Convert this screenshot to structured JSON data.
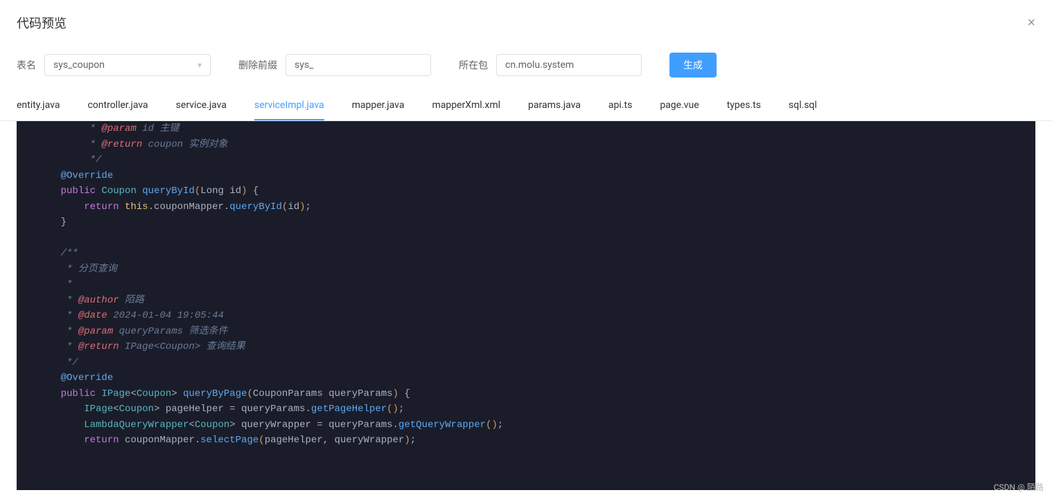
{
  "modal": {
    "title": "代码预览",
    "close": "×"
  },
  "form": {
    "tableLabel": "表名",
    "tableValue": "sys_coupon",
    "prefixLabel": "删除前缀",
    "prefixValue": "sys_",
    "packageLabel": "所在包",
    "packageValue": "cn.molu.system",
    "generateBtn": "生成"
  },
  "tabs": [
    {
      "label": "entity.java",
      "active": false
    },
    {
      "label": "controller.java",
      "active": false
    },
    {
      "label": "service.java",
      "active": false
    },
    {
      "label": "serviceImpl.java",
      "active": true
    },
    {
      "label": "mapper.java",
      "active": false
    },
    {
      "label": "mapperXml.xml",
      "active": false
    },
    {
      "label": "params.java",
      "active": false
    },
    {
      "label": "api.ts",
      "active": false
    },
    {
      "label": "page.vue",
      "active": false
    },
    {
      "label": "types.ts",
      "active": false
    },
    {
      "label": "sql.sql",
      "active": false
    }
  ],
  "code": {
    "lines": [
      {
        "indent": 2,
        "tokens": [
          {
            "t": " * ",
            "c": "comment"
          },
          {
            "t": "@param",
            "c": "doctag"
          },
          {
            "t": " id 主键",
            "c": "comment"
          }
        ]
      },
      {
        "indent": 2,
        "tokens": [
          {
            "t": " * ",
            "c": "comment"
          },
          {
            "t": "@return",
            "c": "doctag"
          },
          {
            "t": " coupon 实例对象",
            "c": "comment"
          }
        ]
      },
      {
        "indent": 2,
        "tokens": [
          {
            "t": " */",
            "c": "comment"
          }
        ]
      },
      {
        "indent": 1,
        "tokens": [
          {
            "t": "@Override",
            "c": "annotation"
          }
        ]
      },
      {
        "indent": 1,
        "tokens": [
          {
            "t": "public",
            "c": "keyword"
          },
          {
            "t": " ",
            "c": ""
          },
          {
            "t": "Coupon",
            "c": "type"
          },
          {
            "t": " ",
            "c": ""
          },
          {
            "t": "queryById",
            "c": "method"
          },
          {
            "t": "(",
            "c": "paren"
          },
          {
            "t": "Long id",
            "c": "var"
          },
          {
            "t": ")",
            "c": "paren"
          },
          {
            "t": " {",
            "c": "punct"
          }
        ]
      },
      {
        "indent": 2,
        "tokens": [
          {
            "t": "return",
            "c": "keyword"
          },
          {
            "t": " ",
            "c": ""
          },
          {
            "t": "this",
            "c": "this"
          },
          {
            "t": ".couponMapper.",
            "c": "var"
          },
          {
            "t": "queryById",
            "c": "method"
          },
          {
            "t": "(",
            "c": "paren"
          },
          {
            "t": "id",
            "c": "var"
          },
          {
            "t": ")",
            "c": "paren"
          },
          {
            "t": ";",
            "c": "punct"
          }
        ]
      },
      {
        "indent": 1,
        "tokens": [
          {
            "t": "}",
            "c": "punct"
          }
        ]
      },
      {
        "indent": 0,
        "tokens": [
          {
            "t": "",
            "c": ""
          }
        ]
      },
      {
        "indent": 1,
        "tokens": [
          {
            "t": "/**",
            "c": "comment"
          }
        ]
      },
      {
        "indent": 1,
        "tokens": [
          {
            "t": " * 分页查询",
            "c": "comment"
          }
        ]
      },
      {
        "indent": 1,
        "tokens": [
          {
            "t": " *",
            "c": "comment"
          }
        ]
      },
      {
        "indent": 1,
        "tokens": [
          {
            "t": " * ",
            "c": "comment"
          },
          {
            "t": "@author",
            "c": "doctag"
          },
          {
            "t": " 陌路",
            "c": "comment"
          }
        ]
      },
      {
        "indent": 1,
        "tokens": [
          {
            "t": " * ",
            "c": "comment"
          },
          {
            "t": "@date",
            "c": "doctag"
          },
          {
            "t": " 2024-01-04 19:05:44",
            "c": "comment"
          }
        ]
      },
      {
        "indent": 1,
        "tokens": [
          {
            "t": " * ",
            "c": "comment"
          },
          {
            "t": "@param",
            "c": "doctag"
          },
          {
            "t": " queryParams 筛选条件",
            "c": "comment"
          }
        ]
      },
      {
        "indent": 1,
        "tokens": [
          {
            "t": " * ",
            "c": "comment"
          },
          {
            "t": "@return",
            "c": "doctag"
          },
          {
            "t": " IPage<Coupon> 查询结果",
            "c": "comment"
          }
        ]
      },
      {
        "indent": 1,
        "tokens": [
          {
            "t": " */",
            "c": "comment"
          }
        ]
      },
      {
        "indent": 1,
        "tokens": [
          {
            "t": "@Override",
            "c": "annotation"
          }
        ]
      },
      {
        "indent": 1,
        "tokens": [
          {
            "t": "public",
            "c": "keyword"
          },
          {
            "t": " ",
            "c": ""
          },
          {
            "t": "IPage",
            "c": "type"
          },
          {
            "t": "<",
            "c": "punct"
          },
          {
            "t": "Coupon",
            "c": "type"
          },
          {
            "t": ">",
            "c": "punct"
          },
          {
            "t": " ",
            "c": ""
          },
          {
            "t": "queryByPage",
            "c": "method"
          },
          {
            "t": "(",
            "c": "paren"
          },
          {
            "t": "CouponParams queryParams",
            "c": "var"
          },
          {
            "t": ")",
            "c": "paren"
          },
          {
            "t": " {",
            "c": "punct"
          }
        ]
      },
      {
        "indent": 2,
        "tokens": [
          {
            "t": "IPage",
            "c": "type"
          },
          {
            "t": "<",
            "c": "punct"
          },
          {
            "t": "Coupon",
            "c": "type"
          },
          {
            "t": ">",
            "c": "punct"
          },
          {
            "t": " pageHelper = queryParams.",
            "c": "var"
          },
          {
            "t": "getPageHelper",
            "c": "method"
          },
          {
            "t": "()",
            "c": "paren"
          },
          {
            "t": ";",
            "c": "punct"
          }
        ]
      },
      {
        "indent": 2,
        "tokens": [
          {
            "t": "LambdaQueryWrapper",
            "c": "type"
          },
          {
            "t": "<",
            "c": "punct"
          },
          {
            "t": "Coupon",
            "c": "type"
          },
          {
            "t": ">",
            "c": "punct"
          },
          {
            "t": " queryWrapper = queryParams.",
            "c": "var"
          },
          {
            "t": "getQueryWrapper",
            "c": "method"
          },
          {
            "t": "()",
            "c": "paren"
          },
          {
            "t": ";",
            "c": "punct"
          }
        ]
      },
      {
        "indent": 2,
        "tokens": [
          {
            "t": "return",
            "c": "keyword"
          },
          {
            "t": " couponMapper.",
            "c": "var"
          },
          {
            "t": "selectPage",
            "c": "method"
          },
          {
            "t": "(",
            "c": "paren"
          },
          {
            "t": "pageHelper, queryWrapper",
            "c": "var"
          },
          {
            "t": ")",
            "c": "paren"
          },
          {
            "t": ";",
            "c": "punct"
          }
        ]
      }
    ]
  },
  "watermark": "CSDN @.陌路"
}
